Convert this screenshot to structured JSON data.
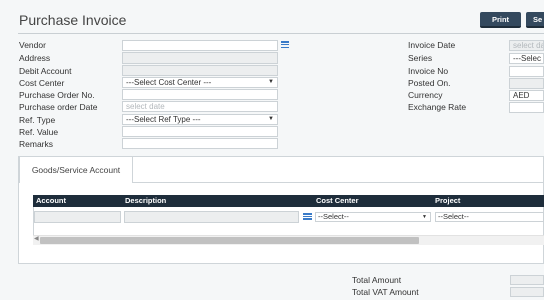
{
  "header": {
    "title": "Purchase Invoice",
    "print_label": "Print",
    "second_button_label": "Se"
  },
  "form_left": {
    "vendor_label": "Vendor",
    "address_label": "Address",
    "debit_account_label": "Debit Account",
    "cost_center_label": "Cost Center",
    "cost_center_value": "---Select Cost Center ---",
    "po_no_label": "Purchase Order No.",
    "po_date_label": "Purchase order Date",
    "po_date_placeholder": "select date",
    "ref_type_label": "Ref. Type",
    "ref_type_value": "---Select Ref Type ---",
    "ref_value_label": "Ref. Value",
    "remarks_label": "Remarks"
  },
  "form_right": {
    "invoice_date_label": "Invoice Date",
    "invoice_date_placeholder": "select da",
    "series_label": "Series",
    "series_value": "---Selec",
    "invoice_no_label": "Invoice No",
    "posted_on_label": "Posted On.",
    "currency_label": "Currency",
    "currency_value": "AED",
    "exchange_rate_label": "Exchange Rate"
  },
  "tabs": [
    {
      "label": "Goods/Service Account"
    }
  ],
  "grid": {
    "columns": [
      "Account",
      "Description",
      "Cost Center",
      "Project"
    ],
    "row": {
      "cost_center_value": "--Select--",
      "project_value": "--Select--"
    }
  },
  "totals": {
    "total_amount_label": "Total Amount",
    "total_vat_label": "Total VAT Amount"
  },
  "colors": {
    "button_bg": "#34495e",
    "grid_header_bg": "#1e2d3b",
    "icon_blue": "#3a7bc8"
  }
}
